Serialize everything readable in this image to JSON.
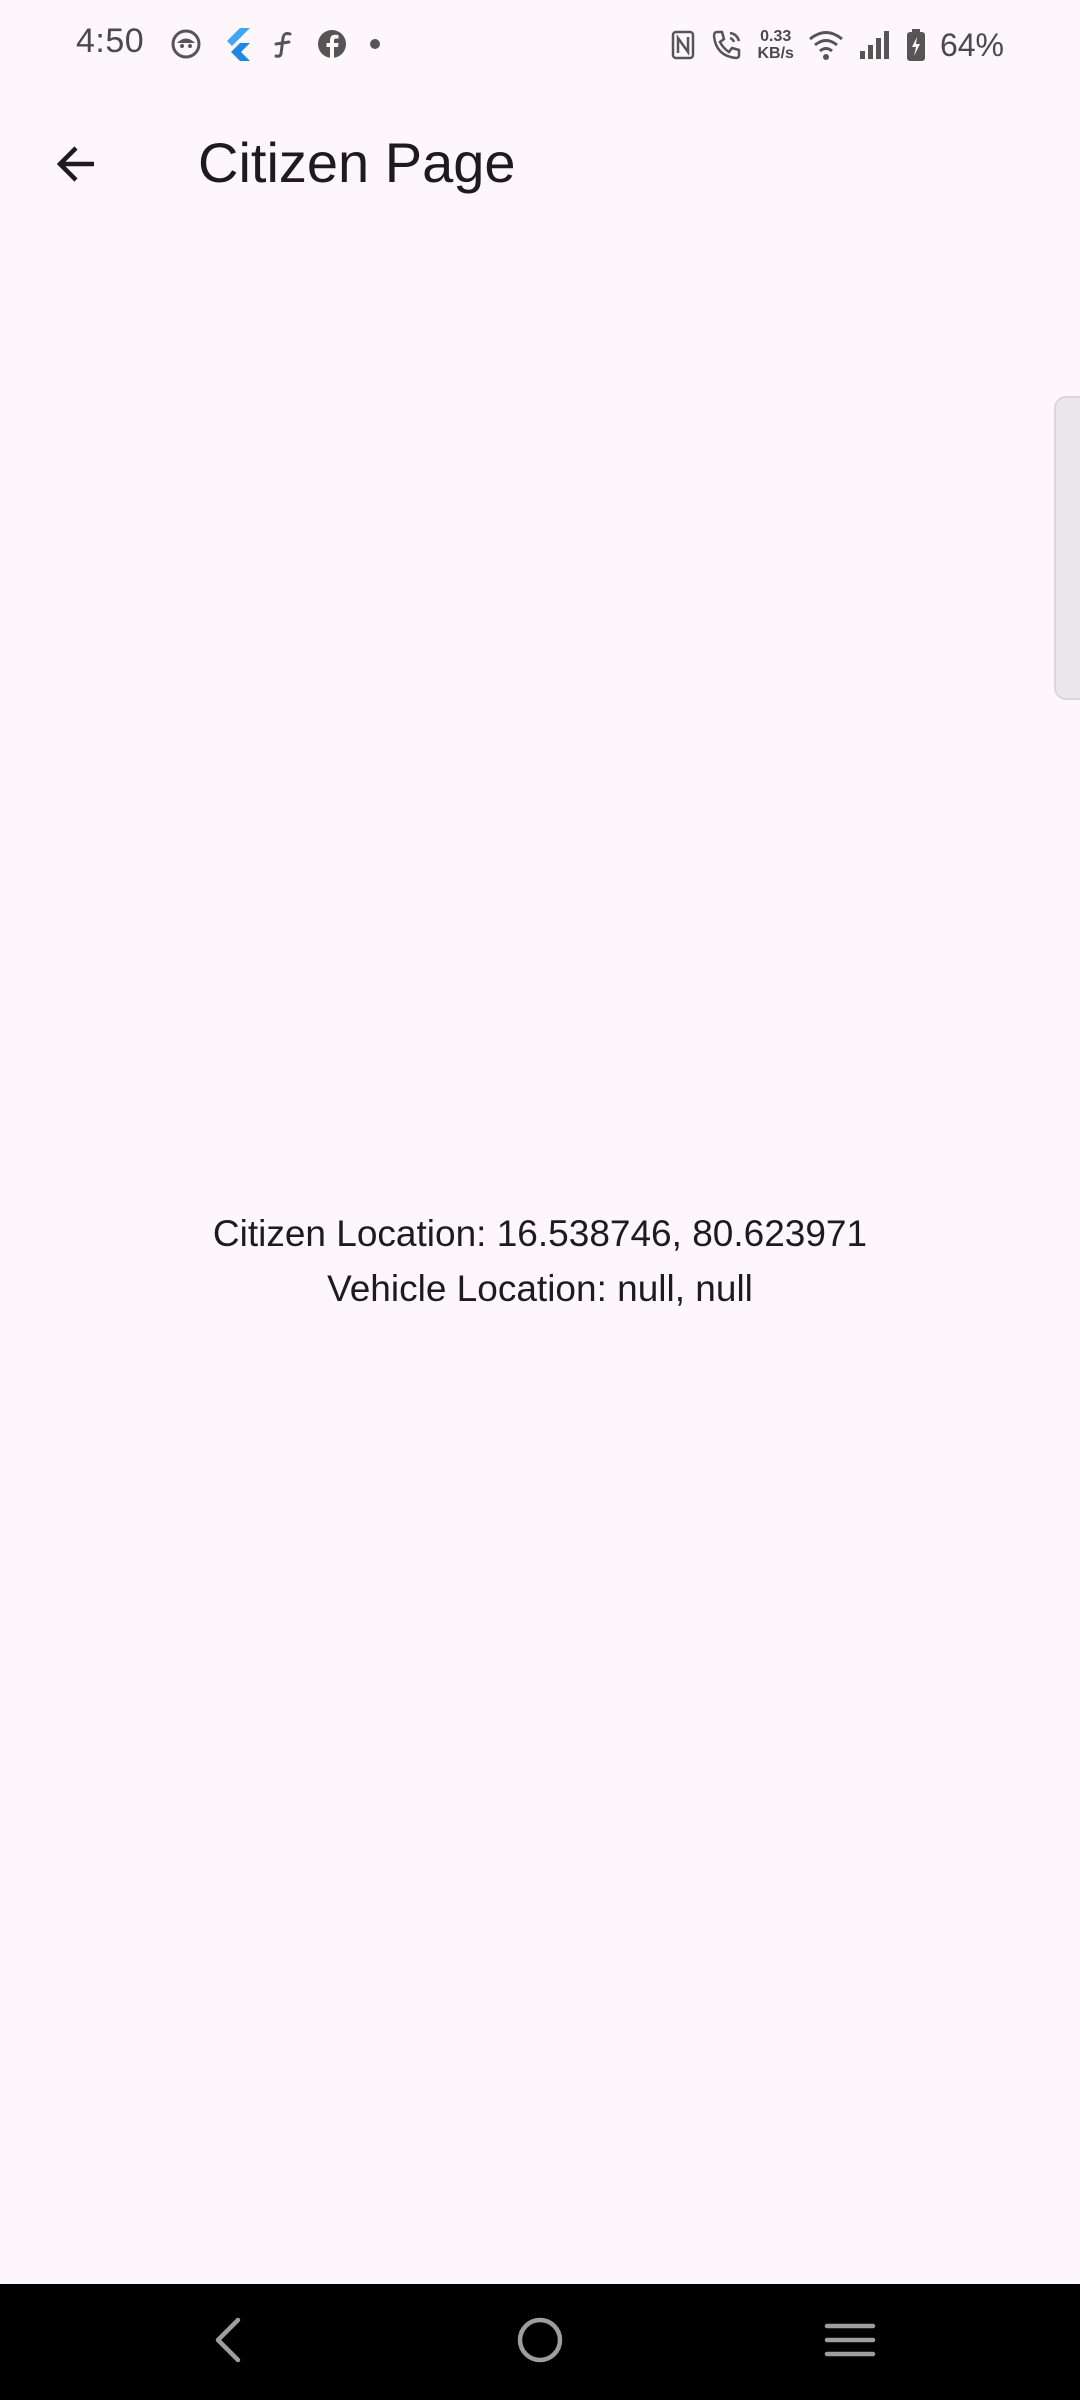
{
  "status_bar": {
    "time": "4:50",
    "left_icons": [
      "emoji-face-icon",
      "flutter-icon",
      "app-f-icon",
      "facebook-icon",
      "dot-icon"
    ],
    "net_speed_value": "0.33",
    "net_speed_unit": "KB/s",
    "battery_percent": "64%"
  },
  "app_bar": {
    "title": "Citizen Page",
    "back_icon": "arrow-back-icon"
  },
  "content": {
    "citizen_location": "Citizen Location: 16.538746, 80.623971",
    "vehicle_location": "Vehicle Location: null, null"
  },
  "nav_bar": {
    "buttons": [
      "nav-back-icon",
      "nav-home-icon",
      "nav-recents-icon"
    ]
  },
  "colors": {
    "background": "#fdf7fc",
    "text": "#1d1b20",
    "status_text": "#4a4a4a",
    "nav_bar": "#000000",
    "flutter_blue": "#42a5f5"
  }
}
